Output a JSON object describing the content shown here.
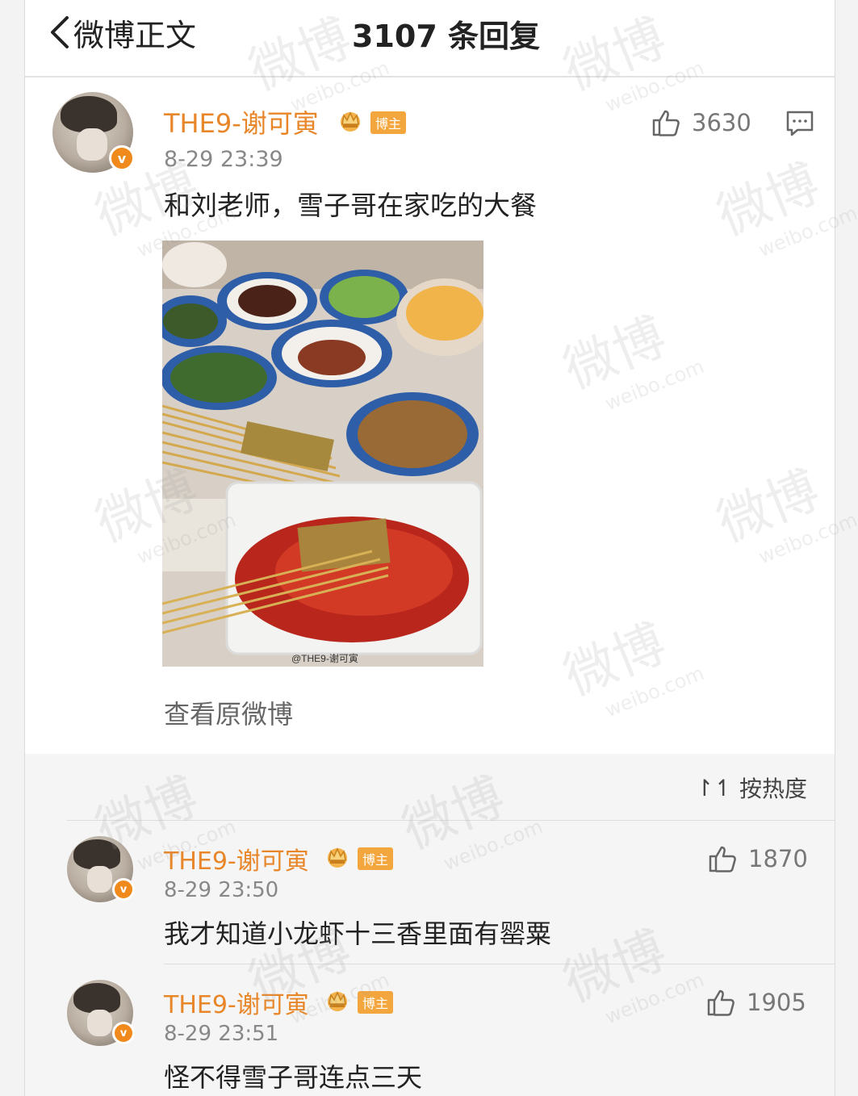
{
  "header": {
    "back_label": "微博正文",
    "title": "3107 条回复"
  },
  "post": {
    "username": "THE9-谢可寅",
    "owner_badge": "博主",
    "time": "8-29 23:39",
    "text": "和刘老师，雪子哥在家吃的大餐",
    "likes": "3630",
    "photo_watermark": "@THE9-谢可寅",
    "view_original": "查看原微博"
  },
  "sort": {
    "icon": "↾↿",
    "label": "按热度"
  },
  "replies": [
    {
      "username": "THE9-谢可寅",
      "owner_badge": "博主",
      "time": "8-29 23:50",
      "text": "我才知道小龙虾十三香里面有罂粟",
      "likes": "1870"
    },
    {
      "username": "THE9-谢可寅",
      "owner_badge": "博主",
      "time": "8-29 23:51",
      "text": "怪不得雪子哥连点三天",
      "likes": "1905"
    }
  ],
  "watermark": {
    "text": "微博",
    "sub": "weibo.com"
  },
  "colors": {
    "username": "#e8862a",
    "badge": "#f4a63e",
    "verified": "#f08a1c"
  }
}
